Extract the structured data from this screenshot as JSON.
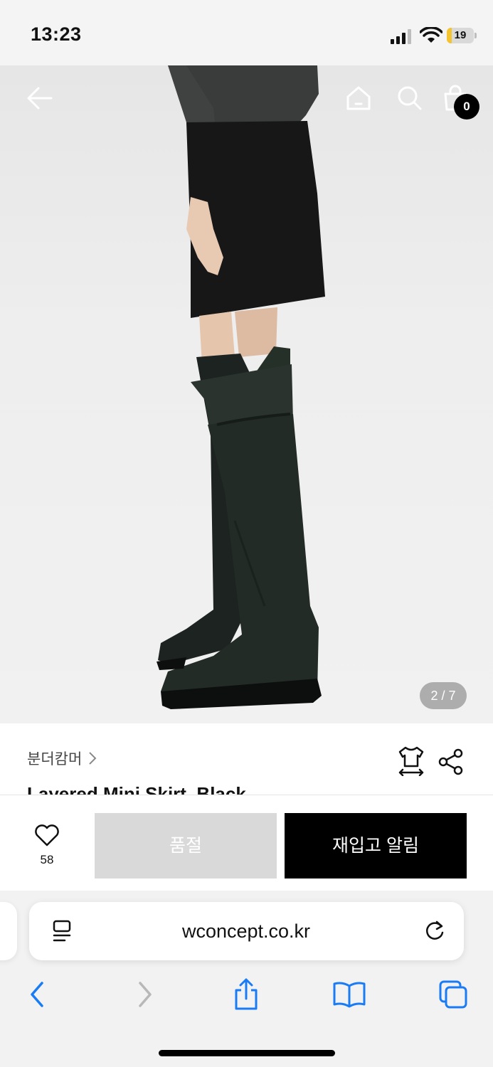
{
  "status_bar": {
    "time": "13:23",
    "battery_text": "19",
    "battery_level": 0.19,
    "icons": [
      "cellular-signal-icon",
      "wifi-icon",
      "battery-charging-icon"
    ]
  },
  "product_image": {
    "page_indicator": "2 / 7",
    "cart_count": "0"
  },
  "info": {
    "brand": "분더캄머",
    "title": "Layered Mini Skirt_Black"
  },
  "actions": {
    "like_count": "58",
    "soldout_label": "품절",
    "restock_label": "재입고 알림"
  },
  "browser": {
    "url": "wconcept.co.kr"
  },
  "colors": {
    "accent": "#000000",
    "soldout_bg": "#d9d9d9",
    "ios_blue": "#1a7cf5",
    "battery_yellow": "#f4c430"
  }
}
